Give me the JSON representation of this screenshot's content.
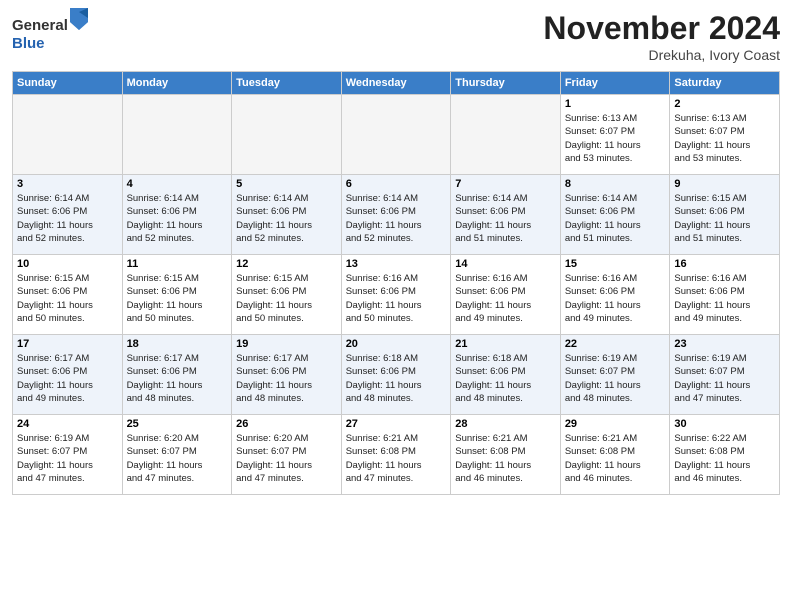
{
  "header": {
    "logo_line1": "General",
    "logo_line2": "Blue",
    "month_title": "November 2024",
    "location": "Drekuha, Ivory Coast"
  },
  "days_of_week": [
    "Sunday",
    "Monday",
    "Tuesday",
    "Wednesday",
    "Thursday",
    "Friday",
    "Saturday"
  ],
  "weeks": [
    {
      "row_class": "week-odd",
      "days": [
        {
          "num": "",
          "info": "",
          "empty": true
        },
        {
          "num": "",
          "info": "",
          "empty": true
        },
        {
          "num": "",
          "info": "",
          "empty": true
        },
        {
          "num": "",
          "info": "",
          "empty": true
        },
        {
          "num": "",
          "info": "",
          "empty": true
        },
        {
          "num": "1",
          "info": "Sunrise: 6:13 AM\nSunset: 6:07 PM\nDaylight: 11 hours\nand 53 minutes.",
          "empty": false
        },
        {
          "num": "2",
          "info": "Sunrise: 6:13 AM\nSunset: 6:07 PM\nDaylight: 11 hours\nand 53 minutes.",
          "empty": false
        }
      ]
    },
    {
      "row_class": "week-even",
      "days": [
        {
          "num": "3",
          "info": "Sunrise: 6:14 AM\nSunset: 6:06 PM\nDaylight: 11 hours\nand 52 minutes.",
          "empty": false
        },
        {
          "num": "4",
          "info": "Sunrise: 6:14 AM\nSunset: 6:06 PM\nDaylight: 11 hours\nand 52 minutes.",
          "empty": false
        },
        {
          "num": "5",
          "info": "Sunrise: 6:14 AM\nSunset: 6:06 PM\nDaylight: 11 hours\nand 52 minutes.",
          "empty": false
        },
        {
          "num": "6",
          "info": "Sunrise: 6:14 AM\nSunset: 6:06 PM\nDaylight: 11 hours\nand 52 minutes.",
          "empty": false
        },
        {
          "num": "7",
          "info": "Sunrise: 6:14 AM\nSunset: 6:06 PM\nDaylight: 11 hours\nand 51 minutes.",
          "empty": false
        },
        {
          "num": "8",
          "info": "Sunrise: 6:14 AM\nSunset: 6:06 PM\nDaylight: 11 hours\nand 51 minutes.",
          "empty": false
        },
        {
          "num": "9",
          "info": "Sunrise: 6:15 AM\nSunset: 6:06 PM\nDaylight: 11 hours\nand 51 minutes.",
          "empty": false
        }
      ]
    },
    {
      "row_class": "week-odd",
      "days": [
        {
          "num": "10",
          "info": "Sunrise: 6:15 AM\nSunset: 6:06 PM\nDaylight: 11 hours\nand 50 minutes.",
          "empty": false
        },
        {
          "num": "11",
          "info": "Sunrise: 6:15 AM\nSunset: 6:06 PM\nDaylight: 11 hours\nand 50 minutes.",
          "empty": false
        },
        {
          "num": "12",
          "info": "Sunrise: 6:15 AM\nSunset: 6:06 PM\nDaylight: 11 hours\nand 50 minutes.",
          "empty": false
        },
        {
          "num": "13",
          "info": "Sunrise: 6:16 AM\nSunset: 6:06 PM\nDaylight: 11 hours\nand 50 minutes.",
          "empty": false
        },
        {
          "num": "14",
          "info": "Sunrise: 6:16 AM\nSunset: 6:06 PM\nDaylight: 11 hours\nand 49 minutes.",
          "empty": false
        },
        {
          "num": "15",
          "info": "Sunrise: 6:16 AM\nSunset: 6:06 PM\nDaylight: 11 hours\nand 49 minutes.",
          "empty": false
        },
        {
          "num": "16",
          "info": "Sunrise: 6:16 AM\nSunset: 6:06 PM\nDaylight: 11 hours\nand 49 minutes.",
          "empty": false
        }
      ]
    },
    {
      "row_class": "week-even",
      "days": [
        {
          "num": "17",
          "info": "Sunrise: 6:17 AM\nSunset: 6:06 PM\nDaylight: 11 hours\nand 49 minutes.",
          "empty": false
        },
        {
          "num": "18",
          "info": "Sunrise: 6:17 AM\nSunset: 6:06 PM\nDaylight: 11 hours\nand 48 minutes.",
          "empty": false
        },
        {
          "num": "19",
          "info": "Sunrise: 6:17 AM\nSunset: 6:06 PM\nDaylight: 11 hours\nand 48 minutes.",
          "empty": false
        },
        {
          "num": "20",
          "info": "Sunrise: 6:18 AM\nSunset: 6:06 PM\nDaylight: 11 hours\nand 48 minutes.",
          "empty": false
        },
        {
          "num": "21",
          "info": "Sunrise: 6:18 AM\nSunset: 6:06 PM\nDaylight: 11 hours\nand 48 minutes.",
          "empty": false
        },
        {
          "num": "22",
          "info": "Sunrise: 6:19 AM\nSunset: 6:07 PM\nDaylight: 11 hours\nand 48 minutes.",
          "empty": false
        },
        {
          "num": "23",
          "info": "Sunrise: 6:19 AM\nSunset: 6:07 PM\nDaylight: 11 hours\nand 47 minutes.",
          "empty": false
        }
      ]
    },
    {
      "row_class": "week-odd",
      "days": [
        {
          "num": "24",
          "info": "Sunrise: 6:19 AM\nSunset: 6:07 PM\nDaylight: 11 hours\nand 47 minutes.",
          "empty": false
        },
        {
          "num": "25",
          "info": "Sunrise: 6:20 AM\nSunset: 6:07 PM\nDaylight: 11 hours\nand 47 minutes.",
          "empty": false
        },
        {
          "num": "26",
          "info": "Sunrise: 6:20 AM\nSunset: 6:07 PM\nDaylight: 11 hours\nand 47 minutes.",
          "empty": false
        },
        {
          "num": "27",
          "info": "Sunrise: 6:21 AM\nSunset: 6:08 PM\nDaylight: 11 hours\nand 47 minutes.",
          "empty": false
        },
        {
          "num": "28",
          "info": "Sunrise: 6:21 AM\nSunset: 6:08 PM\nDaylight: 11 hours\nand 46 minutes.",
          "empty": false
        },
        {
          "num": "29",
          "info": "Sunrise: 6:21 AM\nSunset: 6:08 PM\nDaylight: 11 hours\nand 46 minutes.",
          "empty": false
        },
        {
          "num": "30",
          "info": "Sunrise: 6:22 AM\nSunset: 6:08 PM\nDaylight: 11 hours\nand 46 minutes.",
          "empty": false
        }
      ]
    }
  ]
}
